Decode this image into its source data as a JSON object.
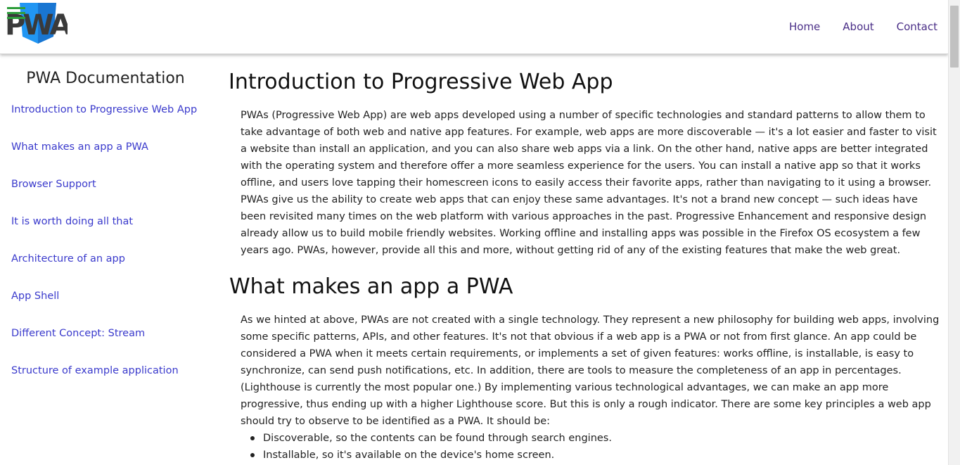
{
  "header": {
    "logo_text": "PWA",
    "nav": [
      "Home",
      "About",
      "Contact"
    ]
  },
  "colors": {
    "nav_link": "#4a2e87",
    "sidebar_link": "#3a3acc",
    "logo_shield": "#2196f3",
    "logo_hamburger": "#2e9e3c"
  },
  "sidebar": {
    "title": "PWA Documentation",
    "items": [
      "Introduction to Progressive Web App",
      "What makes an app a PWA",
      "Browser Support",
      "It is worth doing all that",
      "Architecture of an app",
      "App Shell",
      "Different Concept: Stream",
      "Structure of example application"
    ]
  },
  "main": {
    "sections": [
      {
        "title": "Introduction to Progressive Web App",
        "paragraph": "PWAs (Progressive Web App) are web apps developed using a number of specific technologies and standard patterns to allow them to take advantage of both web and native app features. For example, web apps are more discoverable — it's a lot easier and faster to visit a website than install an application, and you can also share web apps via a link. On the other hand, native apps are better integrated with the operating system and therefore offer a more seamless experience for the users. You can install a native app so that it works offline, and users love tapping their homescreen icons to easily access their favorite apps, rather than navigating to it using a browser. PWAs give us the ability to create web apps that can enjoy these same advantages. It's not a brand new concept — such ideas have been revisited many times on the web platform with various approaches in the past. Progressive Enhancement and responsive design already allow us to build mobile friendly websites. Working offline and installing apps was possible in the Firefox OS ecosystem a few years ago. PWAs, however, provide all this and more, without getting rid of any of the existing features that make the web great."
      },
      {
        "title": "What makes an app a PWA",
        "paragraph": "As we hinted at above, PWAs are not created with a single technology. They represent a new philosophy for building web apps, involving some specific patterns, APIs, and other features. It's not that obvious if a web app is a PWA or not from first glance. An app could be considered a PWA when it meets certain requirements, or implements a set of given features: works offline, is installable, is easy to synchronize, can send push notifications, etc. In addition, there are tools to measure the completeness of an app in percentages. (Lighthouse is currently the most popular one.) By implementing various technological advantages, we can make an app more progressive, thus ending up with a higher Lighthouse score. But this is only a rough indicator. There are some key principles a web app should try to observe to be identified as a PWA. It should be:",
        "bullets": [
          "Discoverable, so the contents can be found through search engines.",
          "Installable, so it's available on the device's home screen."
        ]
      }
    ]
  }
}
